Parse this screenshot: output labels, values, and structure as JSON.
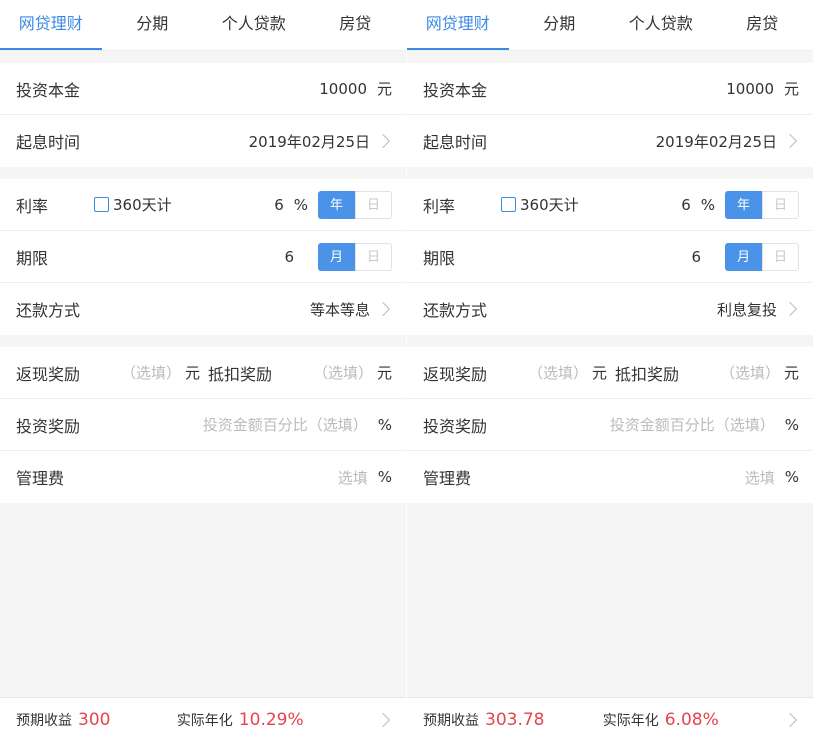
{
  "panels": [
    {
      "tabs": [
        "网贷理财",
        "分期",
        "个人贷款",
        "房贷"
      ],
      "principal": {
        "label": "投资本金",
        "value": "10000",
        "unit": "元"
      },
      "start_date": {
        "label": "起息时间",
        "value": "2019年02月25日"
      },
      "rate": {
        "label": "利率",
        "checkbox_label": "360天计",
        "value": "6",
        "unit": "%",
        "seg": [
          "年",
          "日"
        ]
      },
      "term": {
        "label": "期限",
        "value": "6",
        "seg": [
          "月",
          "日"
        ]
      },
      "repay": {
        "label": "还款方式",
        "value": "等本等息"
      },
      "cashback": {
        "label": "返现奖励",
        "placeholder": "（选填）",
        "unit": "元",
        "label2": "抵扣奖励",
        "placeholder2": "（选填）",
        "unit2": "元"
      },
      "invest_reward": {
        "label": "投资奖励",
        "placeholder": "投资金额百分比（选填）",
        "unit": "%"
      },
      "fee": {
        "label": "管理费",
        "placeholder": "选填",
        "unit": "%"
      },
      "footer": {
        "expected_label": "预期收益",
        "expected_value": "300",
        "annual_label": "实际年化",
        "annual_value": "10.29%"
      }
    },
    {
      "tabs": [
        "网贷理财",
        "分期",
        "个人贷款",
        "房贷"
      ],
      "principal": {
        "label": "投资本金",
        "value": "10000",
        "unit": "元"
      },
      "start_date": {
        "label": "起息时间",
        "value": "2019年02月25日"
      },
      "rate": {
        "label": "利率",
        "checkbox_label": "360天计",
        "value": "6",
        "unit": "%",
        "seg": [
          "年",
          "日"
        ]
      },
      "term": {
        "label": "期限",
        "value": "6",
        "seg": [
          "月",
          "日"
        ]
      },
      "repay": {
        "label": "还款方式",
        "value": "利息复投"
      },
      "cashback": {
        "label": "返现奖励",
        "placeholder": "（选填）",
        "unit": "元",
        "label2": "抵扣奖励",
        "placeholder2": "（选填）",
        "unit2": "元"
      },
      "invest_reward": {
        "label": "投资奖励",
        "placeholder": "投资金额百分比（选填）",
        "unit": "%"
      },
      "fee": {
        "label": "管理费",
        "placeholder": "选填",
        "unit": "%"
      },
      "footer": {
        "expected_label": "预期收益",
        "expected_value": "303.78",
        "annual_label": "实际年化",
        "annual_value": "6.08%"
      }
    }
  ],
  "colors": {
    "accent": "#3d8ae6",
    "highlight": "#e5454c"
  }
}
